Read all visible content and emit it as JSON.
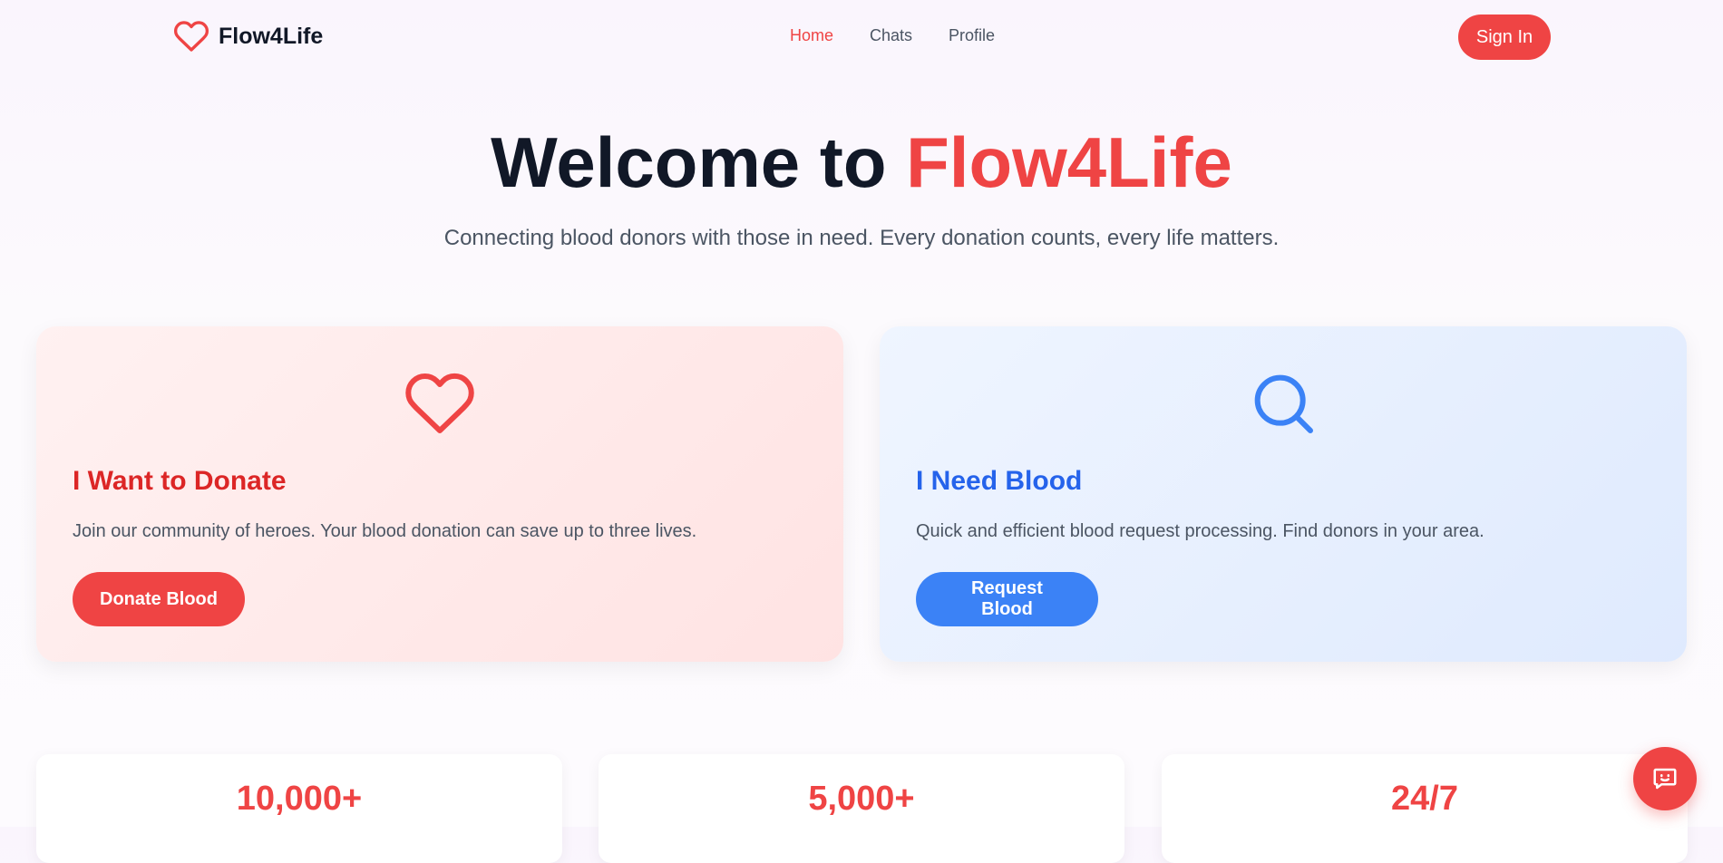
{
  "brand": {
    "name": "Flow4Life",
    "icon": "heart-icon",
    "color": "#ef4444"
  },
  "nav": {
    "links": [
      {
        "label": "Home",
        "active": true
      },
      {
        "label": "Chats",
        "active": false
      },
      {
        "label": "Profile",
        "active": false
      }
    ],
    "signin_label": "Sign In"
  },
  "hero": {
    "title_prefix": "Welcome to",
    "title_accent": "Flow4Life",
    "subtitle": "Connecting blood donors with those in need. Every donation counts, every life matters."
  },
  "cards": [
    {
      "icon": "heart-icon",
      "title": "I Want to Donate",
      "text": "Join our community of heroes. Your blood donation can save up to three lives.",
      "button": "Donate Blood",
      "accent": "#ef4444"
    },
    {
      "icon": "search-icon",
      "title": "I Need Blood",
      "text": "Quick and efficient blood request processing. Find donors in your area.",
      "button": "Request Blood",
      "accent": "#3b82f6"
    }
  ],
  "stats": [
    {
      "value": "10,000+"
    },
    {
      "value": "5,000+"
    },
    {
      "value": "24/7"
    }
  ],
  "chat_fab": {
    "icon": "chat-bubble-icon"
  }
}
